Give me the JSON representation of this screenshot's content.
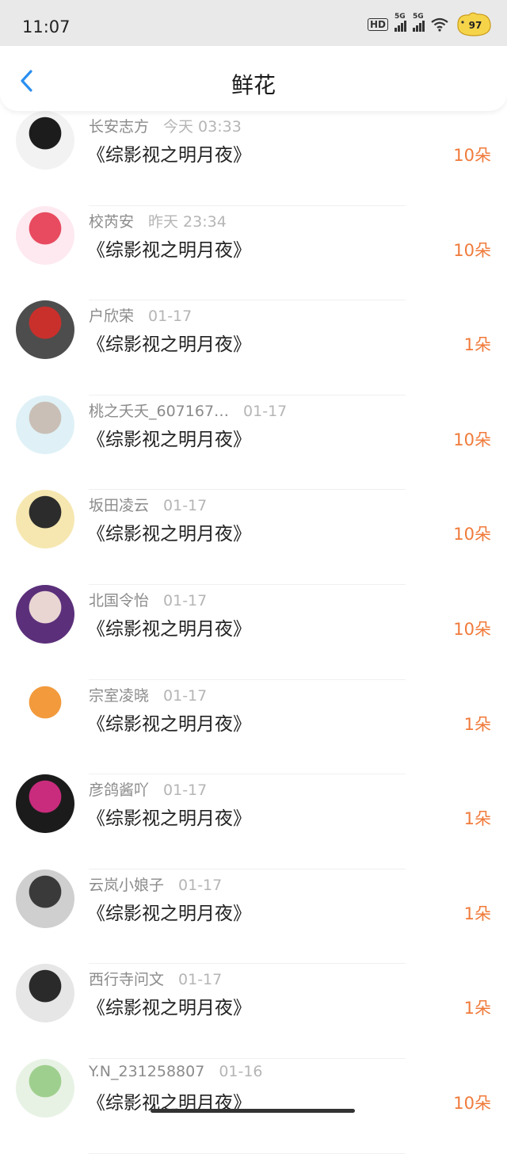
{
  "status_bar": {
    "time": "11:07",
    "hd_label": "HD",
    "sim1_label": "5G",
    "sim2_label": "5G",
    "battery": "97"
  },
  "header": {
    "title": "鲜花",
    "back_icon": "chevron-left-icon"
  },
  "colors": {
    "accent_blue": "#2a8ff0",
    "amount_orange": "#f07a3a",
    "username_gray": "#8b8b8b",
    "date_gray": "#b5b5b5"
  },
  "records": [
    {
      "user": "长安志方",
      "date": "今天 03:33",
      "book": "《综影视之明月夜》",
      "amount": "10朵",
      "avatar_colors": [
        "#f2f2f2",
        "#1c1c1c"
      ]
    },
    {
      "user": "校芮安",
      "date": "昨天 23:34",
      "book": "《综影视之明月夜》",
      "amount": "10朵",
      "avatar_colors": [
        "#fde9ef",
        "#e84a5f"
      ]
    },
    {
      "user": "户欣荣",
      "date": "01-17",
      "book": "《综影视之明月夜》",
      "amount": "1朵",
      "avatar_colors": [
        "#4d4d4d",
        "#c9302c"
      ]
    },
    {
      "user": "桃之夭夭_607167…",
      "date": "01-17",
      "book": "《综影视之明月夜》",
      "amount": "10朵",
      "avatar_colors": [
        "#dff1f6",
        "#c9bfb6"
      ]
    },
    {
      "user": "坂田凌云",
      "date": "01-17",
      "book": "《综影视之明月夜》",
      "amount": "10朵",
      "avatar_colors": [
        "#f6e7b0",
        "#2c2c2c"
      ]
    },
    {
      "user": "北国令怡",
      "date": "01-17",
      "book": "《综影视之明月夜》",
      "amount": "10朵",
      "avatar_colors": [
        "#5b2f7a",
        "#e9d6d3"
      ]
    },
    {
      "user": "宗室凌晓",
      "date": "01-17",
      "book": "《综影视之明月夜》",
      "amount": "1朵",
      "avatar_colors": [
        "#ffffff",
        "#f29a3c"
      ]
    },
    {
      "user": "彦鸽酱吖",
      "date": "01-17",
      "book": "《综影视之明月夜》",
      "amount": "1朵",
      "avatar_colors": [
        "#1b1b1b",
        "#c92c7d"
      ]
    },
    {
      "user": "云岚小娘子",
      "date": "01-17",
      "book": "《综影视之明月夜》",
      "amount": "1朵",
      "avatar_colors": [
        "#cfcfcf",
        "#3a3a3a"
      ]
    },
    {
      "user": "西行寺问文",
      "date": "01-17",
      "book": "《综影视之明月夜》",
      "amount": "1朵",
      "avatar_colors": [
        "#e6e6e6",
        "#2a2a2a"
      ]
    },
    {
      "user": "Y.N_231258807",
      "date": "01-16",
      "book": "《综影视之明月夜》",
      "amount": "10朵",
      "avatar_colors": [
        "#e7f2e4",
        "#9fcf8e"
      ]
    }
  ]
}
